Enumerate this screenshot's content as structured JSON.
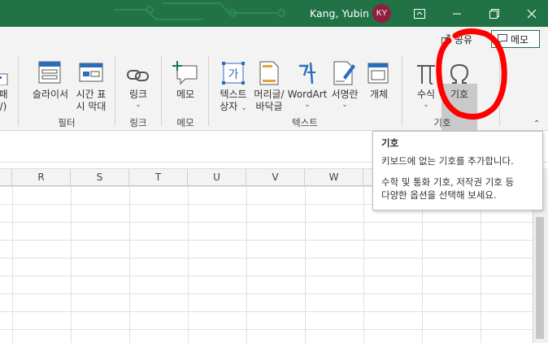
{
  "titlebar": {
    "user_name": "Kang, Yubin",
    "avatar_initials": "KY",
    "bg_color": "#217346"
  },
  "header": {
    "share_label": "공유",
    "memo_label": "메모"
  },
  "ribbon": {
    "partial_left": {
      "line1": "패",
      "line2": "/)"
    },
    "commands": {
      "slicer": "슬라이서",
      "timeline_l1": "시간 표",
      "timeline_l2": "시 막대",
      "link": "링크",
      "memo": "메모",
      "textbox_l1": "텍스트",
      "textbox_l2": "상자",
      "headerfooter_l1": "머리글/",
      "headerfooter_l2": "바닥글",
      "wordart": "WordArt",
      "signature": "서명란",
      "object": "개체",
      "equation": "수식",
      "symbol": "기호"
    },
    "groups": {
      "filter": "필터",
      "link": "링크",
      "memo": "메모",
      "text": "텍스트",
      "symbol": "기호"
    }
  },
  "grid": {
    "columns": [
      "R",
      "S",
      "T",
      "U",
      "V",
      "W"
    ]
  },
  "tooltip": {
    "title": "기호",
    "line1": "키보드에 없는 기호를 추가합니다.",
    "line2": "수학 및 통화 기호, 저작권 기호 등",
    "line3": "다양한 옵션을 선택해 보세요."
  },
  "annotation": {
    "color": "#ff0000"
  }
}
